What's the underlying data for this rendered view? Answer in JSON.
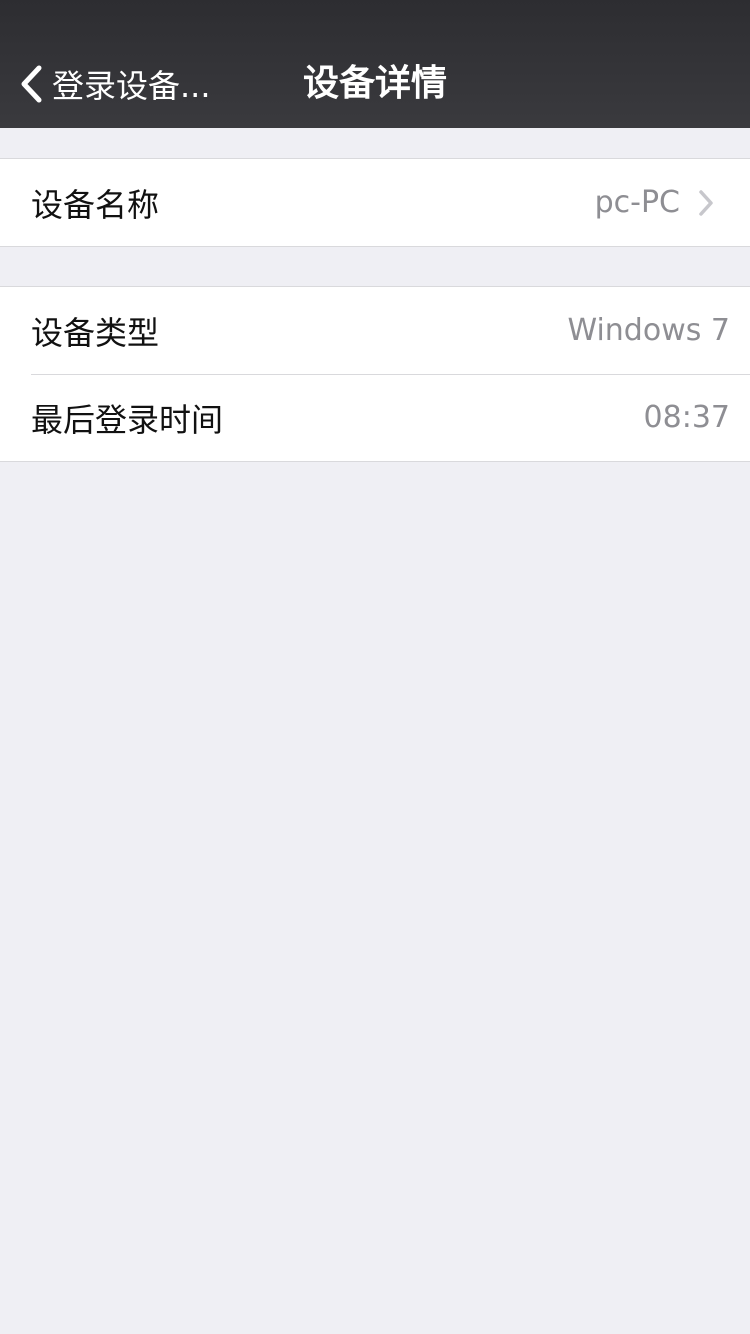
{
  "nav": {
    "back_label": "登录设备...",
    "back_icon": "chevron-left-icon",
    "title": "设备详情"
  },
  "device_name": {
    "label": "设备名称",
    "value": "pc-PC",
    "icon": "chevron-right-icon"
  },
  "details": {
    "type_label": "设备类型",
    "type_value": "Windows 7",
    "last_login_label": "最后登录时间",
    "last_login_value": "08:37"
  },
  "colors": {
    "nav_background": "#333337",
    "page_background": "#efeff4",
    "value_text": "#8e8e93",
    "chevron": "#c7c7cc"
  }
}
